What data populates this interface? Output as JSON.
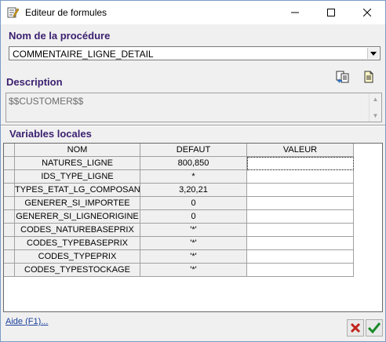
{
  "window": {
    "title": "Editeur de formules",
    "icon": "formula-editor-icon",
    "controls": [
      "minimize-icon",
      "maximize-icon",
      "close-icon"
    ]
  },
  "procedure": {
    "label": "Nom de la procédure",
    "value": "COMMENTAIRE_LIGNE_DETAIL"
  },
  "description": {
    "label": "Description",
    "value": "$$CUSTOMER$$"
  },
  "toolbar": {
    "icons": [
      "copy-formula-icon",
      "document-icon"
    ]
  },
  "variables": {
    "label": "Variables locales",
    "columns": [
      "NOM",
      "DEFAUT",
      "VALEUR"
    ],
    "rows": [
      {
        "nom": "NATURES_LIGNE",
        "defaut": "800,850",
        "valeur": ""
      },
      {
        "nom": "IDS_TYPE_LIGNE",
        "defaut": "*",
        "valeur": ""
      },
      {
        "nom": "TYPES_ETAT_LG_COMPOSANT",
        "defaut": "3,20,21",
        "valeur": ""
      },
      {
        "nom": "GENERER_SI_IMPORTEE",
        "defaut": "0",
        "valeur": ""
      },
      {
        "nom": "GENERER_SI_LIGNEORIGINE",
        "defaut": "0",
        "valeur": ""
      },
      {
        "nom": "CODES_NATUREBASEPRIX",
        "defaut": "'*'",
        "valeur": ""
      },
      {
        "nom": "CODES_TYPEBASEPRIX",
        "defaut": "'*'",
        "valeur": ""
      },
      {
        "nom": "CODES_TYPEPRIX",
        "defaut": "'*'",
        "valeur": ""
      },
      {
        "nom": "CODES_TYPESTOCKAGE",
        "defaut": "'*'",
        "valeur": ""
      }
    ]
  },
  "footer": {
    "help": "Aide (F1)...",
    "cancel_icon": "red-x-icon",
    "ok_icon": "green-check-icon"
  },
  "colors": {
    "section_title": "#3a1f6f",
    "link": "#1a3f9c",
    "cancel": "#c0241c",
    "ok": "#1a8a2a"
  }
}
